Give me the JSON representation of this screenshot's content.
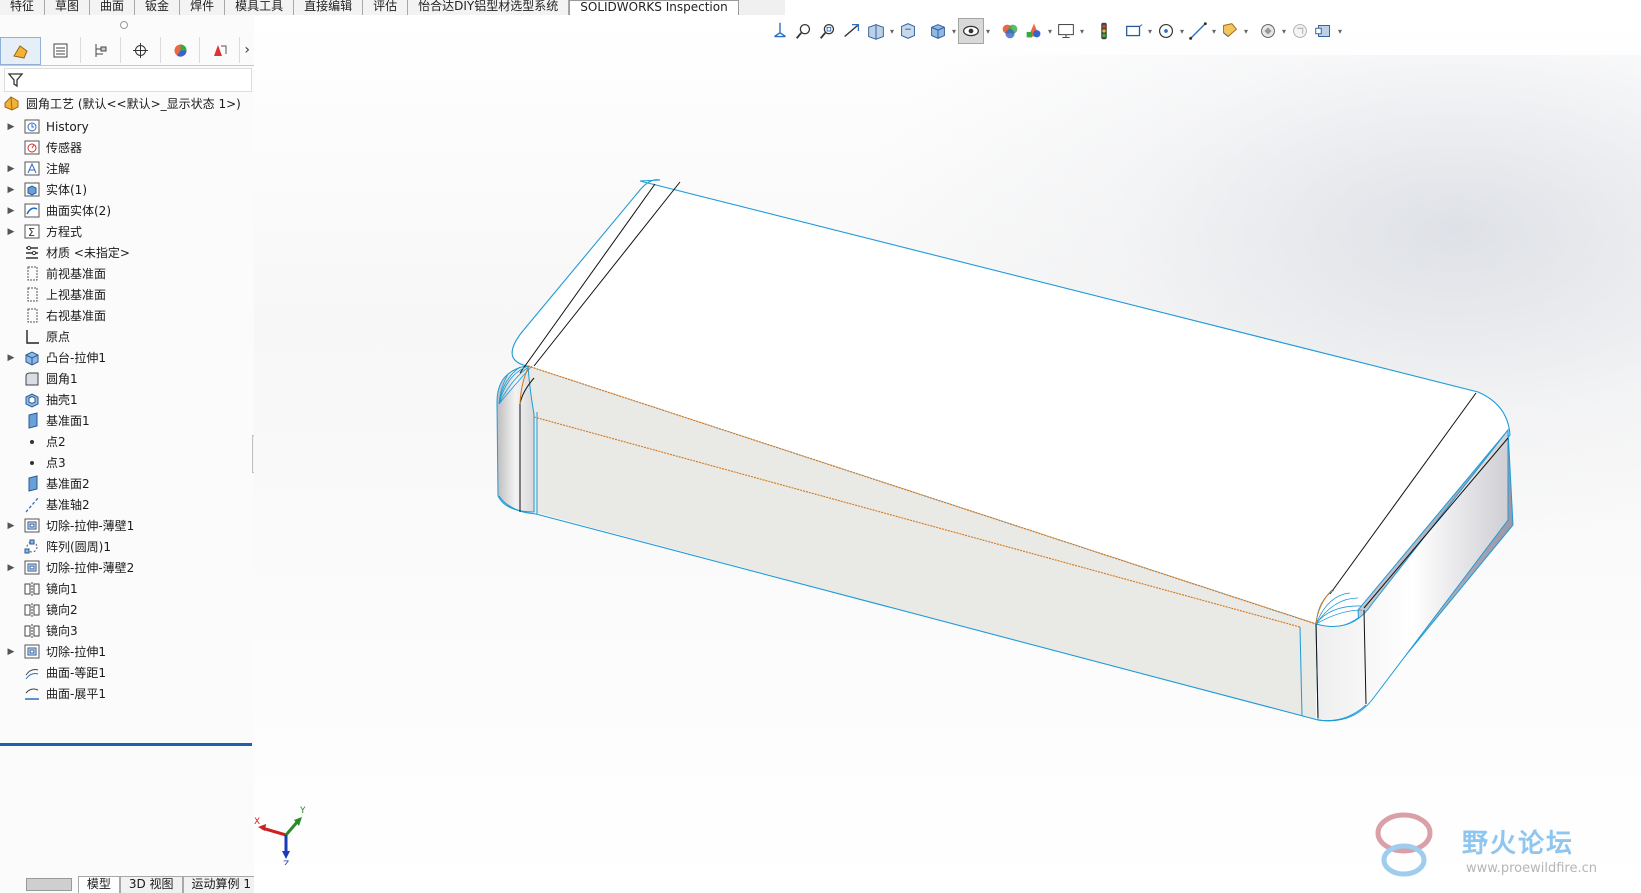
{
  "command_tabs": [
    "特征",
    "草图",
    "曲面",
    "钣金",
    "焊件",
    "模具工具",
    "直接编辑",
    "评估",
    "怡合达DIY铝型材选型系统",
    "SOLIDWORKS Inspection"
  ],
  "active_command_tab": "SOLIDWORKS Inspection",
  "panel_tabs": [
    {
      "icon": "feature-manager-icon"
    },
    {
      "icon": "property-manager-icon"
    },
    {
      "icon": "configuration-manager-icon"
    },
    {
      "icon": "dimxpert-manager-icon"
    },
    {
      "icon": "display-manager-icon"
    },
    {
      "icon": "cam-manager-icon"
    }
  ],
  "panel_more": "›",
  "tree_root": {
    "icon": "part-icon",
    "label": "圆角工艺 (默认<<默认>_显示状态 1>)"
  },
  "tree_items": [
    {
      "label": "History",
      "icon": "history-icon",
      "expand": true
    },
    {
      "label": "传感器",
      "icon": "sensor-icon",
      "expand": false
    },
    {
      "label": "注解",
      "icon": "annotation-icon",
      "expand": true
    },
    {
      "label": "实体(1)",
      "icon": "solid-body-icon",
      "expand": true
    },
    {
      "label": "曲面实体(2)",
      "icon": "surface-body-icon",
      "expand": true
    },
    {
      "label": "方程式",
      "icon": "equation-icon",
      "expand": true
    },
    {
      "label": "材质 <未指定>",
      "icon": "material-icon",
      "expand": false
    },
    {
      "label": "前视基准面",
      "icon": "plane-icon",
      "expand": false
    },
    {
      "label": "上视基准面",
      "icon": "plane-icon",
      "expand": false
    },
    {
      "label": "右视基准面",
      "icon": "plane-icon",
      "expand": false
    },
    {
      "label": "原点",
      "icon": "origin-icon",
      "expand": false
    },
    {
      "label": "凸台-拉伸1",
      "icon": "boss-extrude-icon",
      "expand": true
    },
    {
      "label": "圆角1",
      "icon": "fillet-icon",
      "expand": false
    },
    {
      "label": "抽壳1",
      "icon": "shell-icon",
      "expand": false
    },
    {
      "label": "基准面1",
      "icon": "ref-plane-icon",
      "expand": false
    },
    {
      "label": "点2",
      "icon": "point-icon",
      "expand": false
    },
    {
      "label": "点3",
      "icon": "point-icon",
      "expand": false
    },
    {
      "label": "基准面2",
      "icon": "ref-plane-icon",
      "expand": false
    },
    {
      "label": "基准轴2",
      "icon": "axis-icon",
      "expand": false
    },
    {
      "label": "切除-拉伸-薄壁1",
      "icon": "cut-extrude-icon",
      "expand": true
    },
    {
      "label": "阵列(圆周)1",
      "icon": "circular-pattern-icon",
      "expand": false
    },
    {
      "label": "切除-拉伸-薄壁2",
      "icon": "cut-extrude-icon",
      "expand": true
    },
    {
      "label": "镜向1",
      "icon": "mirror-icon",
      "expand": false
    },
    {
      "label": "镜向2",
      "icon": "mirror-icon",
      "expand": false
    },
    {
      "label": "镜向3",
      "icon": "mirror-icon",
      "expand": false
    },
    {
      "label": "切除-拉伸1",
      "icon": "cut-extrude-icon",
      "expand": true
    },
    {
      "label": "曲面-等距1",
      "icon": "offset-surface-icon",
      "expand": false
    },
    {
      "label": "曲面-展平1",
      "icon": "flatten-surface-icon",
      "expand": false
    }
  ],
  "bottom_tabs": [
    "模型",
    "3D 视图",
    "运动算例 1"
  ],
  "active_bottom_tab": "模型",
  "heads_up_toolbar": [
    "view-orientation-icon",
    "zoom-to-fit-icon",
    "zoom-to-area-icon",
    "previous-view-icon",
    "section-view-icon",
    "dynamic-annotation-icon",
    "view-orientation-cube-icon",
    "display-style-icon",
    "hide-show-items-icon",
    "edit-appearance-icon",
    "apply-scene-icon",
    "view-settings-icon",
    "realview-icon",
    "sketch-relations-icon",
    "hide-show-circle-icon",
    "line-icon",
    "rebuild-icon",
    "3d-sketch-icon",
    "component-icon",
    "display-pane-icon"
  ],
  "triad_axes": {
    "x": "X",
    "y": "Y",
    "z": "Z"
  },
  "watermark": {
    "title": "野火论坛",
    "url": "www.proewildfire.cn"
  },
  "colors": {
    "edge_blue": "#1e9bd7",
    "edge_orange": "#d4771c",
    "accent": "#1f5fb2"
  }
}
